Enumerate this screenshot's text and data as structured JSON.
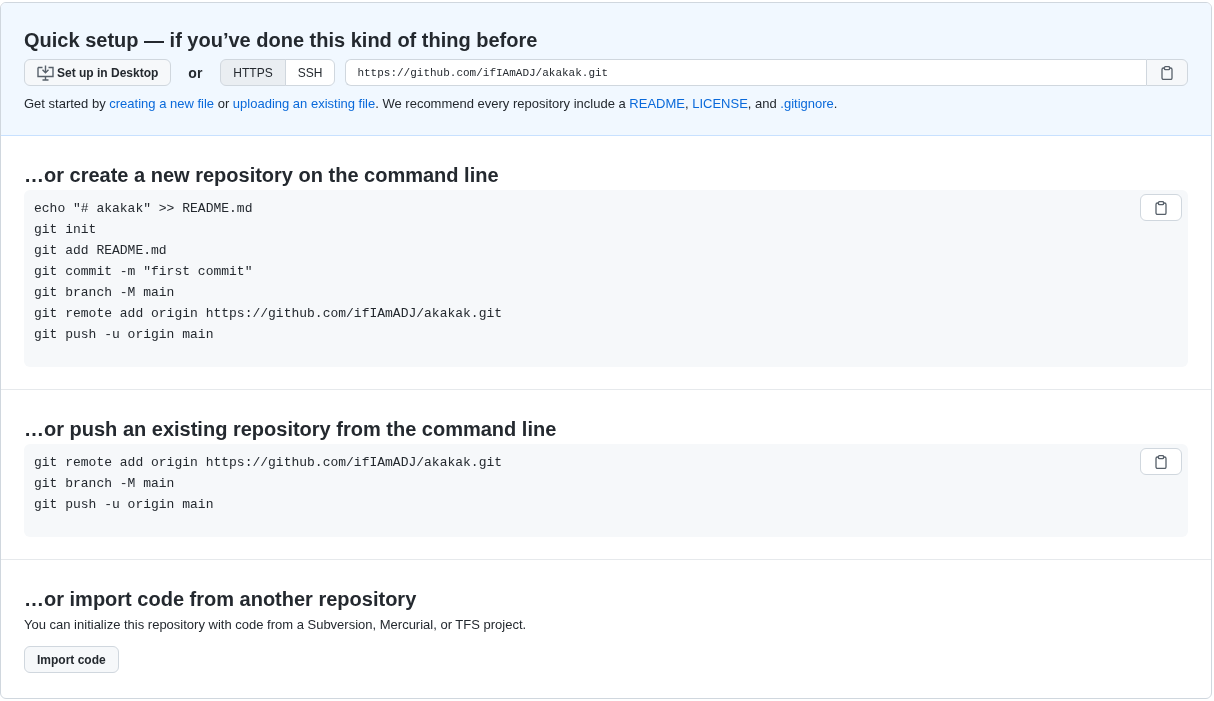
{
  "quick_setup": {
    "title": "Quick setup — if you’ve done this kind of thing before",
    "desktop_button": "Set up in Desktop",
    "or": "or",
    "protocols": [
      {
        "label": "HTTPS",
        "selected": true
      },
      {
        "label": "SSH",
        "selected": false
      }
    ],
    "url": "https://github.com/ifIAmADJ/akakak.git",
    "hint": [
      {
        "kind": "text",
        "text": "Get started by "
      },
      {
        "kind": "link",
        "text": "creating a new file"
      },
      {
        "kind": "text",
        "text": " or "
      },
      {
        "kind": "link",
        "text": "uploading an existing file"
      },
      {
        "kind": "text",
        "text": ". We recommend every repository include a "
      },
      {
        "kind": "link",
        "text": "README"
      },
      {
        "kind": "text",
        "text": ", "
      },
      {
        "kind": "link",
        "text": "LICENSE"
      },
      {
        "kind": "text",
        "text": ", and "
      },
      {
        "kind": "link",
        "text": ".gitignore"
      },
      {
        "kind": "text",
        "text": "."
      }
    ]
  },
  "sections": [
    {
      "title": "…or create a new repository on the command line",
      "code": [
        "echo \"# akakak\" >> README.md",
        "git init",
        "git add README.md",
        "git commit -m \"first commit\"",
        "git branch -M main",
        "git remote add origin https://github.com/ifIAmADJ/akakak.git",
        "git push -u origin main"
      ]
    },
    {
      "title": "…or push an existing repository from the command line",
      "code": [
        "git remote add origin https://github.com/ifIAmADJ/akakak.git",
        "git branch -M main",
        "git push -u origin main"
      ]
    }
  ],
  "import": {
    "title": "…or import code from another repository",
    "text": "You can initialize this repository with code from a Subversion, Mercurial, or TFS project.",
    "button": "Import code"
  }
}
